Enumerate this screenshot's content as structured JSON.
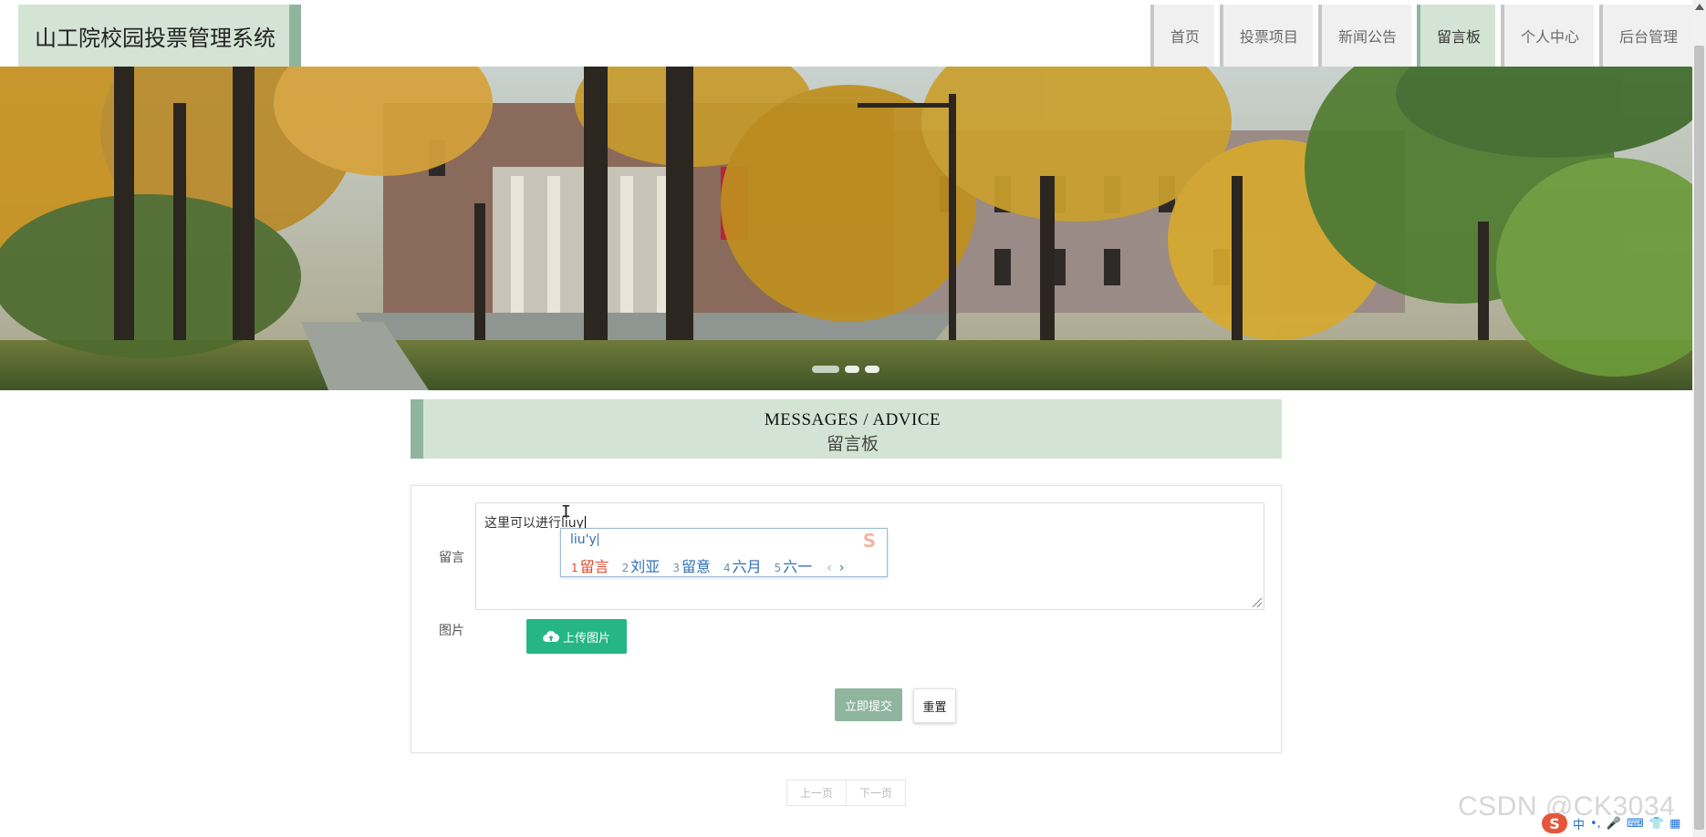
{
  "header": {
    "brand": "山工院校园投票管理系统",
    "nav": [
      "首页",
      "投票项目",
      "新闻公告",
      "留言板",
      "个人中心",
      "后台管理"
    ],
    "active_index": 3
  },
  "section": {
    "title_en": "MESSAGES / ADVICE",
    "title_cn": "留言板"
  },
  "form": {
    "message_label": "留言",
    "message_value": "这里可以进行liuy",
    "image_label": "图片",
    "upload_label": "上传图片",
    "submit_label": "立即提交",
    "reset_label": "重置"
  },
  "ime": {
    "composition": "liu'y",
    "candidates": [
      {
        "num": "1",
        "text": "留言"
      },
      {
        "num": "2",
        "text": "刘亚"
      },
      {
        "num": "3",
        "text": "留意"
      },
      {
        "num": "4",
        "text": "六月"
      },
      {
        "num": "5",
        "text": "六一"
      }
    ],
    "prev": "‹",
    "next": "›",
    "logo": "S"
  },
  "pager": {
    "prev": "上一页",
    "next": "下一页"
  },
  "watermark": "CSDN @CK3034",
  "ime_bar": {
    "logo": "S",
    "items": [
      "中",
      "•,",
      "🎤",
      "⌨",
      "👕",
      "▦"
    ]
  },
  "colors": {
    "accent": "#8fb59e",
    "accent_light": "#d4e4d4",
    "upload_green": "#26b686"
  }
}
